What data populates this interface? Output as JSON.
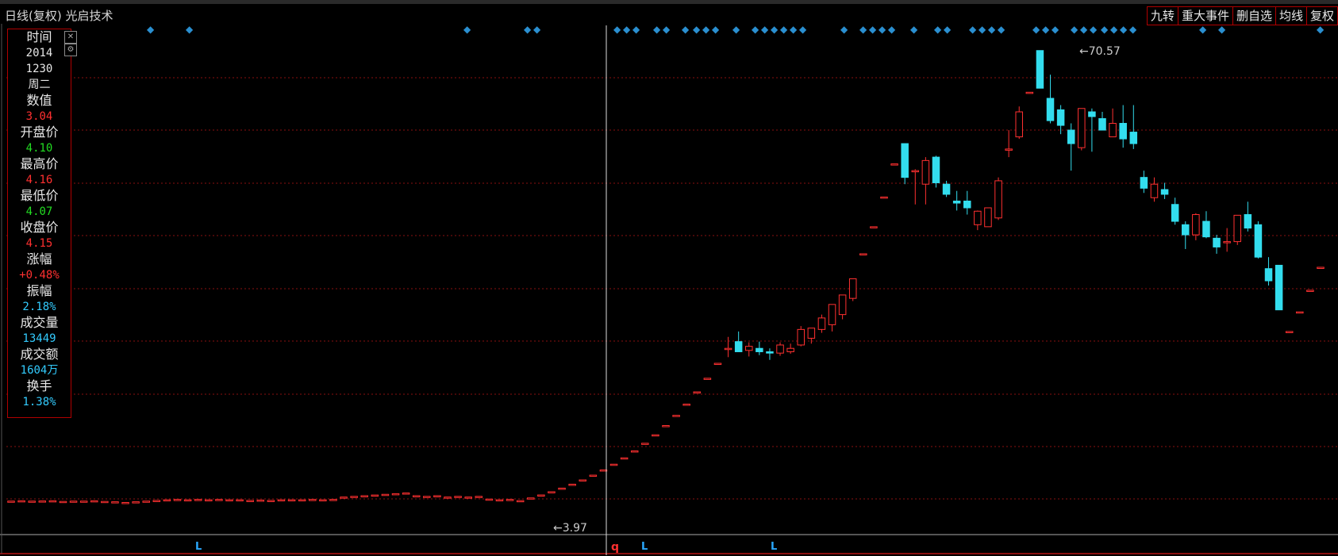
{
  "header": {
    "title": "日线(复权) 光启技术",
    "buttons": [
      "九转",
      "重大事件",
      "删自选",
      "均线",
      "复权"
    ]
  },
  "info_panel": {
    "rows": [
      {
        "label": "时间",
        "values": [
          "2014",
          "1230",
          "周二"
        ],
        "color": "#e8e8e8"
      },
      {
        "label": "数值",
        "values": [
          "3.04"
        ],
        "color": "#ff3030"
      },
      {
        "label": "开盘价",
        "values": [
          "4.10"
        ],
        "color": "#22dd22"
      },
      {
        "label": "最高价",
        "values": [
          "4.16"
        ],
        "color": "#ff3030"
      },
      {
        "label": "最低价",
        "values": [
          "4.07"
        ],
        "color": "#22dd22"
      },
      {
        "label": "收盘价",
        "values": [
          "4.15"
        ],
        "color": "#ff3030"
      },
      {
        "label": "涨幅",
        "values": [
          "+0.48%"
        ],
        "color": "#ff3030"
      },
      {
        "label": "振幅",
        "values": [
          "2.18%"
        ],
        "color": "#33ccff"
      },
      {
        "label": "成交量",
        "values": [
          "13449"
        ],
        "color": "#33ccff"
      },
      {
        "label": "成交额",
        "values": [
          "1604万"
        ],
        "color": "#33ccff"
      },
      {
        "label": "换手",
        "values": [
          "1.38%"
        ],
        "color": "#33ccff"
      }
    ],
    "close_icon": "close-icon",
    "settings_icon": "gear-icon"
  },
  "chart_data": {
    "type": "candlestick",
    "title": "",
    "annotations": {
      "high_label": "70.57",
      "low_label": "3.97"
    },
    "colors": {
      "up": "#ff3030",
      "down": "#33ddee",
      "grid": "#8a1010",
      "crosshair": "#dddddd"
    },
    "ylim": [
      0,
      80
    ],
    "candles": [
      {
        "o": 3.9,
        "h": 3.9,
        "l": 3.9,
        "c": 3.9
      },
      {
        "o": 3.95,
        "h": 3.95,
        "l": 3.95,
        "c": 3.95
      },
      {
        "o": 3.9,
        "h": 3.9,
        "l": 3.9,
        "c": 3.9
      },
      {
        "o": 3.92,
        "h": 3.92,
        "l": 3.92,
        "c": 3.92
      },
      {
        "o": 3.95,
        "h": 3.95,
        "l": 3.95,
        "c": 3.95
      },
      {
        "o": 3.85,
        "h": 3.85,
        "l": 3.85,
        "c": 3.85
      },
      {
        "o": 3.9,
        "h": 3.9,
        "l": 3.9,
        "c": 3.9
      },
      {
        "o": 3.9,
        "h": 3.9,
        "l": 3.9,
        "c": 3.9
      },
      {
        "o": 3.95,
        "h": 3.95,
        "l": 3.95,
        "c": 3.95
      },
      {
        "o": 3.85,
        "h": 3.85,
        "l": 3.85,
        "c": 3.85
      },
      {
        "o": 3.8,
        "h": 3.8,
        "l": 3.8,
        "c": 3.8
      },
      {
        "o": 3.7,
        "h": 3.7,
        "l": 3.7,
        "c": 3.7
      },
      {
        "o": 3.8,
        "h": 3.8,
        "l": 3.8,
        "c": 3.8
      },
      {
        "o": 3.9,
        "h": 3.9,
        "l": 3.9,
        "c": 3.9
      },
      {
        "o": 4.0,
        "h": 4.0,
        "l": 4.0,
        "c": 4.0
      },
      {
        "o": 4.1,
        "h": 4.1,
        "l": 4.1,
        "c": 4.1
      },
      {
        "o": 4.15,
        "h": 4.15,
        "l": 4.15,
        "c": 4.15
      },
      {
        "o": 4.1,
        "h": 4.1,
        "l": 4.1,
        "c": 4.1
      },
      {
        "o": 4.15,
        "h": 4.15,
        "l": 4.15,
        "c": 4.15
      },
      {
        "o": 4.1,
        "h": 4.1,
        "l": 4.1,
        "c": 4.1
      },
      {
        "o": 4.15,
        "h": 4.15,
        "l": 4.15,
        "c": 4.15
      },
      {
        "o": 4.1,
        "h": 4.1,
        "l": 4.1,
        "c": 4.1
      },
      {
        "o": 4.1,
        "h": 4.1,
        "l": 4.1,
        "c": 4.1
      },
      {
        "o": 4.0,
        "h": 4.0,
        "l": 4.0,
        "c": 4.0
      },
      {
        "o": 4.05,
        "h": 4.05,
        "l": 4.05,
        "c": 4.05
      },
      {
        "o": 4.0,
        "h": 4.0,
        "l": 4.0,
        "c": 4.0
      },
      {
        "o": 4.1,
        "h": 4.1,
        "l": 4.1,
        "c": 4.1
      },
      {
        "o": 4.1,
        "h": 4.1,
        "l": 4.1,
        "c": 4.1
      },
      {
        "o": 4.1,
        "h": 4.1,
        "l": 4.1,
        "c": 4.1
      },
      {
        "o": 4.15,
        "h": 4.15,
        "l": 4.15,
        "c": 4.15
      },
      {
        "o": 4.1,
        "h": 4.1,
        "l": 4.1,
        "c": 4.1
      },
      {
        "o": 4.15,
        "h": 4.15,
        "l": 4.15,
        "c": 4.15
      },
      {
        "o": 4.5,
        "h": 4.5,
        "l": 4.5,
        "c": 4.5
      },
      {
        "o": 4.6,
        "h": 4.6,
        "l": 4.6,
        "c": 4.6
      },
      {
        "o": 4.7,
        "h": 4.7,
        "l": 4.7,
        "c": 4.7
      },
      {
        "o": 4.8,
        "h": 4.8,
        "l": 4.8,
        "c": 4.8
      },
      {
        "o": 4.9,
        "h": 4.9,
        "l": 4.9,
        "c": 4.9
      },
      {
        "o": 5.0,
        "h": 5.0,
        "l": 5.0,
        "c": 5.0
      },
      {
        "o": 5.1,
        "h": 5.1,
        "l": 5.1,
        "c": 5.1
      },
      {
        "o": 4.7,
        "h": 4.7,
        "l": 4.7,
        "c": 4.7
      },
      {
        "o": 4.6,
        "h": 4.6,
        "l": 4.6,
        "c": 4.6
      },
      {
        "o": 4.7,
        "h": 4.7,
        "l": 4.7,
        "c": 4.7
      },
      {
        "o": 4.5,
        "h": 4.5,
        "l": 4.5,
        "c": 4.5
      },
      {
        "o": 4.6,
        "h": 4.6,
        "l": 4.6,
        "c": 4.6
      },
      {
        "o": 4.5,
        "h": 4.5,
        "l": 4.5,
        "c": 4.5
      },
      {
        "o": 4.6,
        "h": 4.6,
        "l": 4.6,
        "c": 4.6
      },
      {
        "o": 4.2,
        "h": 4.2,
        "l": 4.2,
        "c": 4.2
      },
      {
        "o": 4.1,
        "h": 4.1,
        "l": 4.1,
        "c": 4.1
      },
      {
        "o": 4.15,
        "h": 4.15,
        "l": 4.15,
        "c": 4.15
      },
      {
        "o": 3.97,
        "h": 3.97,
        "l": 3.97,
        "c": 3.97
      },
      {
        "o": 4.37,
        "h": 4.37,
        "l": 4.37,
        "c": 4.37
      },
      {
        "o": 4.81,
        "h": 4.81,
        "l": 4.81,
        "c": 4.81
      },
      {
        "o": 5.29,
        "h": 5.29,
        "l": 5.29,
        "c": 5.29
      },
      {
        "o": 5.82,
        "h": 5.82,
        "l": 5.82,
        "c": 5.82
      },
      {
        "o": 6.4,
        "h": 6.4,
        "l": 6.4,
        "c": 6.4
      },
      {
        "o": 7.04,
        "h": 7.04,
        "l": 7.04,
        "c": 7.04
      },
      {
        "o": 7.74,
        "h": 7.74,
        "l": 7.74,
        "c": 7.74
      },
      {
        "o": 8.51,
        "h": 8.51,
        "l": 8.51,
        "c": 8.51
      },
      {
        "o": 9.36,
        "h": 9.36,
        "l": 9.36,
        "c": 9.36
      },
      {
        "o": 10.3,
        "h": 10.3,
        "l": 10.3,
        "c": 10.3
      },
      {
        "o": 11.33,
        "h": 11.33,
        "l": 11.33,
        "c": 11.33
      },
      {
        "o": 12.46,
        "h": 12.46,
        "l": 12.46,
        "c": 12.46
      },
      {
        "o": 13.71,
        "h": 13.71,
        "l": 13.71,
        "c": 13.71
      },
      {
        "o": 15.08,
        "h": 15.08,
        "l": 15.08,
        "c": 15.08
      },
      {
        "o": 16.59,
        "h": 16.59,
        "l": 16.59,
        "c": 16.59
      },
      {
        "o": 18.25,
        "h": 18.25,
        "l": 18.25,
        "c": 18.25
      },
      {
        "o": 20.07,
        "h": 20.07,
        "l": 20.07,
        "c": 20.07
      },
      {
        "o": 22.08,
        "h": 22.08,
        "l": 22.08,
        "c": 22.08
      },
      {
        "o": 24.29,
        "h": 24.29,
        "l": 24.29,
        "c": 24.29
      },
      {
        "o": 26.5,
        "h": 28.2,
        "l": 25.2,
        "c": 26.5
      },
      {
        "o": 27.5,
        "h": 29.0,
        "l": 26.0,
        "c": 26.0
      },
      {
        "o": 26.2,
        "h": 27.4,
        "l": 25.3,
        "c": 26.8
      },
      {
        "o": 26.5,
        "h": 27.5,
        "l": 25.5,
        "c": 26.0
      },
      {
        "o": 26.0,
        "h": 26.5,
        "l": 24.8,
        "c": 25.8
      },
      {
        "o": 25.8,
        "h": 27.4,
        "l": 25.4,
        "c": 27.0
      },
      {
        "o": 26.0,
        "h": 27.2,
        "l": 25.7,
        "c": 26.5
      },
      {
        "o": 27.0,
        "h": 29.8,
        "l": 26.8,
        "c": 29.3
      },
      {
        "o": 28.0,
        "h": 29.5,
        "l": 27.2,
        "c": 29.5
      },
      {
        "o": 29.3,
        "h": 31.5,
        "l": 28.8,
        "c": 31.0
      },
      {
        "o": 30.0,
        "h": 33.0,
        "l": 29.0,
        "c": 33.0
      },
      {
        "o": 31.5,
        "h": 34.0,
        "l": 30.8,
        "c": 34.4
      },
      {
        "o": 33.9,
        "h": 36.8,
        "l": 33.5,
        "c": 36.8
      },
      {
        "o": 40.5,
        "h": 40.5,
        "l": 40.5,
        "c": 40.5
      },
      {
        "o": 44.5,
        "h": 44.5,
        "l": 44.5,
        "c": 44.5
      },
      {
        "o": 48.9,
        "h": 48.9,
        "l": 48.9,
        "c": 48.9
      },
      {
        "o": 53.8,
        "h": 53.8,
        "l": 53.8,
        "c": 53.8
      },
      {
        "o": 56.8,
        "h": 56.8,
        "l": 50.8,
        "c": 51.8
      },
      {
        "o": 52.8,
        "h": 53.0,
        "l": 47.8,
        "c": 52.8
      },
      {
        "o": 50.8,
        "h": 54.8,
        "l": 47.8,
        "c": 54.3
      },
      {
        "o": 54.8,
        "h": 55.0,
        "l": 50.3,
        "c": 51.0
      },
      {
        "o": 50.8,
        "h": 51.3,
        "l": 48.9,
        "c": 49.3
      },
      {
        "o": 48.3,
        "h": 49.8,
        "l": 46.9,
        "c": 48.0
      },
      {
        "o": 48.3,
        "h": 49.8,
        "l": 46.3,
        "c": 47.3
      },
      {
        "o": 44.8,
        "h": 46.9,
        "l": 44.0,
        "c": 46.8
      },
      {
        "o": 44.5,
        "h": 47.3,
        "l": 44.5,
        "c": 47.3
      },
      {
        "o": 45.8,
        "h": 51.8,
        "l": 45.5,
        "c": 51.3
      },
      {
        "o": 56.0,
        "h": 58.8,
        "l": 54.8,
        "c": 56.0
      },
      {
        "o": 57.8,
        "h": 62.3,
        "l": 57.5,
        "c": 61.5
      },
      {
        "o": 64.4,
        "h": 64.4,
        "l": 64.4,
        "c": 64.4
      },
      {
        "o": 70.57,
        "h": 70.57,
        "l": 65.0,
        "c": 65.0
      },
      {
        "o": 63.5,
        "h": 67.0,
        "l": 59.8,
        "c": 60.2
      },
      {
        "o": 61.8,
        "h": 62.5,
        "l": 58.2,
        "c": 59.5
      },
      {
        "o": 58.8,
        "h": 59.8,
        "l": 52.8,
        "c": 56.8
      },
      {
        "o": 56.2,
        "h": 62.0,
        "l": 55.8,
        "c": 62.0
      },
      {
        "o": 61.5,
        "h": 62.0,
        "l": 55.6,
        "c": 60.8
      },
      {
        "o": 60.5,
        "h": 61.5,
        "l": 58.8,
        "c": 58.8
      },
      {
        "o": 57.8,
        "h": 62.0,
        "l": 57.8,
        "c": 59.8
      },
      {
        "o": 59.8,
        "h": 62.5,
        "l": 56.2,
        "c": 57.5
      },
      {
        "o": 58.5,
        "h": 62.5,
        "l": 56.0,
        "c": 56.8
      },
      {
        "o": 51.8,
        "h": 52.8,
        "l": 49.5,
        "c": 50.2
      },
      {
        "o": 48.8,
        "h": 51.8,
        "l": 48.2,
        "c": 50.8
      },
      {
        "o": 50.0,
        "h": 51.0,
        "l": 48.6,
        "c": 49.3
      },
      {
        "o": 47.8,
        "h": 48.8,
        "l": 44.8,
        "c": 45.3
      },
      {
        "o": 44.8,
        "h": 45.3,
        "l": 41.2,
        "c": 43.3
      },
      {
        "o": 43.3,
        "h": 46.5,
        "l": 42.5,
        "c": 46.3
      },
      {
        "o": 45.3,
        "h": 46.8,
        "l": 42.8,
        "c": 43.0
      },
      {
        "o": 42.8,
        "h": 43.3,
        "l": 40.5,
        "c": 41.5
      },
      {
        "o": 42.3,
        "h": 44.3,
        "l": 40.8,
        "c": 42.3
      },
      {
        "o": 42.3,
        "h": 46.2,
        "l": 41.8,
        "c": 46.2
      },
      {
        "o": 46.3,
        "h": 48.2,
        "l": 43.8,
        "c": 44.3
      },
      {
        "o": 44.8,
        "h": 45.3,
        "l": 39.8,
        "c": 40.0
      },
      {
        "o": 38.3,
        "h": 40.0,
        "l": 35.8,
        "c": 36.5
      },
      {
        "o": 38.8,
        "h": 38.8,
        "l": 32.2,
        "c": 32.2
      },
      {
        "o": 29.0,
        "h": 29.0,
        "l": 29.0,
        "c": 29.0
      },
      {
        "o": 31.9,
        "h": 31.9,
        "l": 31.9,
        "c": 31.9
      },
      {
        "o": 35.1,
        "h": 35.1,
        "l": 35.1,
        "c": 35.1
      },
      {
        "o": 38.5,
        "h": 38.5,
        "l": 38.5,
        "c": 38.5
      }
    ],
    "top_markers": [
      "◆",
      "◆",
      "◆",
      "◆",
      "◆",
      "◆",
      "◆",
      "◆",
      "◆",
      "◆",
      "◆",
      "◆",
      "◆",
      "◆",
      "◆",
      "◆",
      "◆",
      "◆",
      "◆",
      "◆",
      "◆",
      "◆",
      "◆",
      "◆",
      "◆",
      "◆",
      "◆",
      "◆",
      "◆",
      "◆",
      "◆",
      "◆",
      "◆",
      "◆",
      "◆",
      "◆",
      "◆",
      "◆",
      "◆",
      "◆",
      "◆",
      "◆",
      "◆",
      "◆",
      "◆",
      "◆",
      "◆"
    ],
    "bottom_markers": [
      "L",
      "L",
      "L"
    ],
    "bottom_q_marker": "q"
  }
}
